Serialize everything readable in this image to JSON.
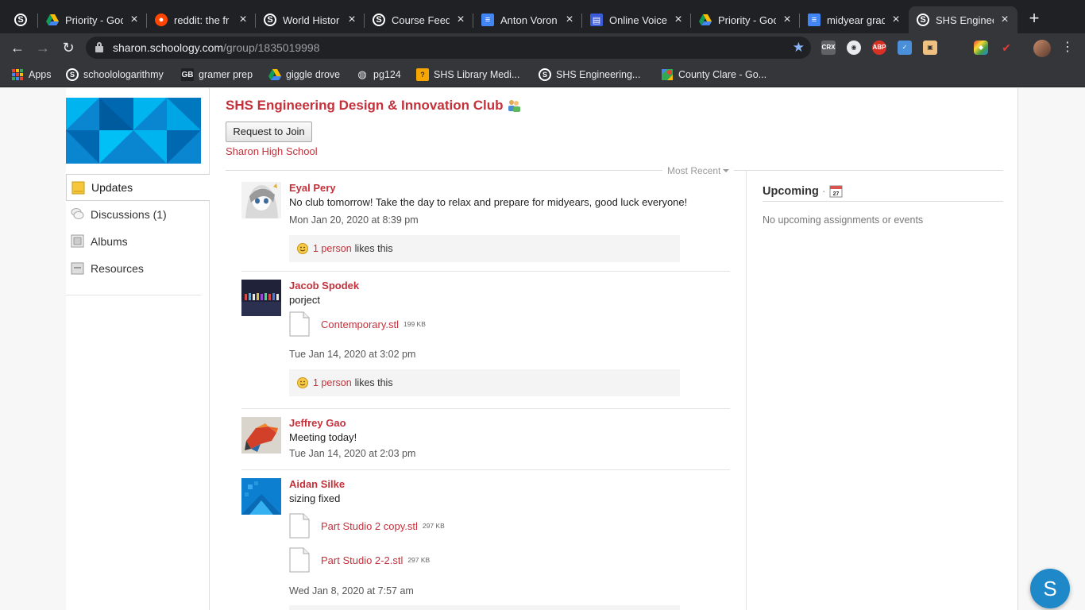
{
  "browser": {
    "tabs": [
      {
        "title": "",
        "icon": "schoology-icon"
      },
      {
        "title": "Priority - Goo",
        "icon": "google-drive-icon"
      },
      {
        "title": "reddit: the fr",
        "icon": "reddit-icon"
      },
      {
        "title": "World Histor",
        "icon": "schoology-icon"
      },
      {
        "title": "Course Feedb",
        "icon": "schoology-icon"
      },
      {
        "title": "Anton Voron",
        "icon": "google-docs-icon"
      },
      {
        "title": "Online Voice",
        "icon": "voice-recorder-icon"
      },
      {
        "title": "Priority - Goo",
        "icon": "google-drive-icon"
      },
      {
        "title": "midyear grad",
        "icon": "google-docs-icon"
      },
      {
        "title": "SHS Enginee",
        "icon": "schoology-icon",
        "active": true
      }
    ],
    "url_host": "sharon.schoology.com",
    "url_path": "/group/1835019998",
    "extensions": [
      "CRX",
      "ABP"
    ],
    "bookmarks": [
      {
        "label": "Apps",
        "icon": "apps-grid-icon"
      },
      {
        "label": "schoolologarithmy",
        "icon": "schoology-icon"
      },
      {
        "label": "gramer prep",
        "icon": "gb-icon"
      },
      {
        "label": "giggle drove",
        "icon": "google-drive-icon"
      },
      {
        "label": "pg124",
        "icon": "globe-icon"
      },
      {
        "label": "SHS Library Medi...",
        "icon": "library-icon"
      },
      {
        "label": "SHS Engineering...",
        "icon": "schoology-icon"
      },
      {
        "label": "County Clare - Go...",
        "icon": "google-maps-icon"
      }
    ]
  },
  "group": {
    "title": "SHS Engineering Design & Innovation Club",
    "join_label": "Request to Join",
    "school": "Sharon High School"
  },
  "nav": {
    "items": [
      {
        "label": "Updates",
        "active": true,
        "icon": "updates-icon"
      },
      {
        "label": "Discussions (1)",
        "icon": "discussions-icon"
      },
      {
        "label": "Albums",
        "icon": "albums-icon"
      },
      {
        "label": "Resources",
        "icon": "resources-icon"
      }
    ]
  },
  "feed": {
    "sort_label": "Most Recent",
    "posts": [
      {
        "author": "Eyal Pery",
        "body": "No club tomorrow! Take the day to relax and prepare for midyears, good luck everyone!",
        "date": "Mon Jan 20, 2020 at 8:39 pm",
        "likes_link": "1 person",
        "likes_suffix": "likes this"
      },
      {
        "author": "Jacob Spodek",
        "body": "porject",
        "files": [
          {
            "name": "Contemporary.stl",
            "size": "199 KB"
          }
        ],
        "date": "Tue Jan 14, 2020 at 3:02 pm",
        "likes_link": "1 person",
        "likes_suffix": "likes this"
      },
      {
        "author": "Jeffrey Gao",
        "body": "Meeting today!",
        "date": "Tue Jan 14, 2020 at 2:03 pm"
      },
      {
        "author": "Aidan Silke",
        "body": "sizing fixed",
        "files": [
          {
            "name": "Part Studio 2 copy.stl",
            "size": "297 KB"
          },
          {
            "name": "Part Studio 2-2.stl",
            "size": "297 KB"
          }
        ],
        "date": "Wed Jan 8, 2020 at 7:57 am"
      }
    ]
  },
  "upcoming": {
    "title": "Upcoming",
    "calendar_day": "27",
    "empty_text": "No upcoming assignments or events"
  },
  "help_button": "S",
  "colors": {
    "brand_red": "#c4313b",
    "schoology_blue": "#1e88c9",
    "chrome_dark": "#202124",
    "chrome_toolbar": "#35363a"
  }
}
